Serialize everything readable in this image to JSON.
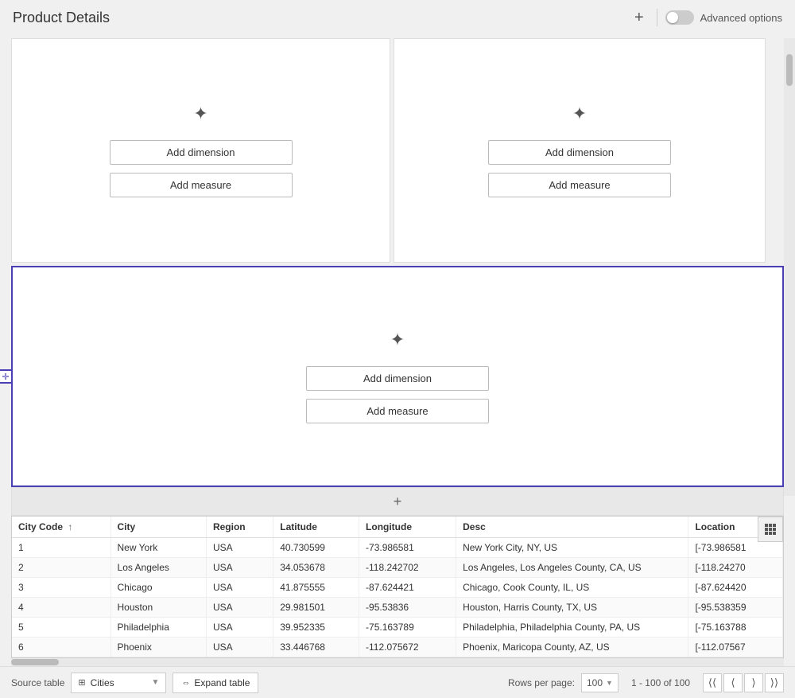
{
  "header": {
    "title": "Product Details",
    "add_btn": "+",
    "advanced_options_label": "Advanced options"
  },
  "panels": {
    "panel1": {
      "add_dimension_label": "Add dimension",
      "add_measure_label": "Add measure"
    },
    "panel2": {
      "add_dimension_label": "Add dimension",
      "add_measure_label": "Add measure"
    },
    "panel3": {
      "add_dimension_label": "Add dimension",
      "add_measure_label": "Add measure"
    }
  },
  "table": {
    "columns": [
      {
        "key": "city_code",
        "label": "City Code",
        "sortable": true
      },
      {
        "key": "city",
        "label": "City"
      },
      {
        "key": "region",
        "label": "Region"
      },
      {
        "key": "latitude",
        "label": "Latitude"
      },
      {
        "key": "longitude",
        "label": "Longitude"
      },
      {
        "key": "desc",
        "label": "Desc"
      },
      {
        "key": "location",
        "label": "Location"
      }
    ],
    "rows": [
      {
        "city_code": "1",
        "city": "New York",
        "region": "USA",
        "latitude": "40.730599",
        "longitude": "-73.986581",
        "desc": "New York City, NY, US",
        "location": "[-73.986581"
      },
      {
        "city_code": "2",
        "city": "Los Angeles",
        "region": "USA",
        "latitude": "34.053678",
        "longitude": "-118.242702",
        "desc": "Los Angeles, Los Angeles County, CA, US",
        "location": "[-118.24270"
      },
      {
        "city_code": "3",
        "city": "Chicago",
        "region": "USA",
        "latitude": "41.875555",
        "longitude": "-87.624421",
        "desc": "Chicago, Cook County, IL, US",
        "location": "[-87.624420"
      },
      {
        "city_code": "4",
        "city": "Houston",
        "region": "USA",
        "latitude": "29.981501",
        "longitude": "-95.53836",
        "desc": "Houston, Harris County, TX, US",
        "location": "[-95.538359"
      },
      {
        "city_code": "5",
        "city": "Philadelphia",
        "region": "USA",
        "latitude": "39.952335",
        "longitude": "-75.163789",
        "desc": "Philadelphia, Philadelphia County, PA, US",
        "location": "[-75.163788"
      },
      {
        "city_code": "6",
        "city": "Phoenix",
        "region": "USA",
        "latitude": "33.446768",
        "longitude": "-112.075672",
        "desc": "Phoenix, Maricopa County, AZ, US",
        "location": "[-112.07567"
      }
    ]
  },
  "footer": {
    "source_table_label": "Source table",
    "table_name": "Cities",
    "expand_table_label": "Expand table",
    "rows_per_page_label": "Rows per page:",
    "rows_per_page_value": "100",
    "pagination_info": "1 - 100 of 100"
  }
}
